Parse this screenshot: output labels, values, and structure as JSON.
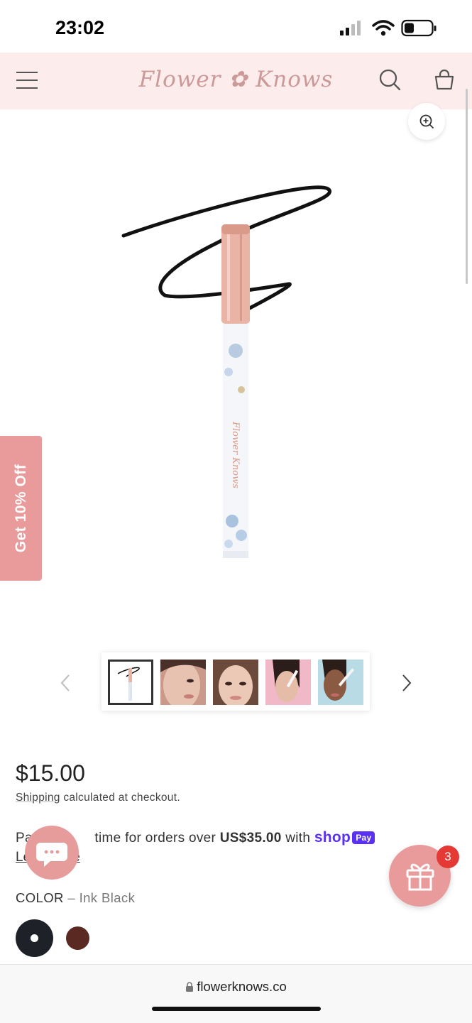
{
  "status_bar": {
    "time": "23:02"
  },
  "header": {
    "logo_text": "Flower ✿ Knows",
    "menu_icon": "hamburger-icon",
    "search_icon": "search-icon",
    "cart_icon": "bag-icon"
  },
  "promo": {
    "discount_tab": "Get 10% Off"
  },
  "gallery": {
    "thumbnails": [
      "eyeliner-product",
      "model-1",
      "model-2",
      "model-3",
      "model-4"
    ],
    "selected_index": 0
  },
  "product": {
    "price": "$15.00",
    "shipping_link": "Shipping",
    "shipping_rest": " calculated at checkout.",
    "pay_prefix": "Pa",
    "pay_middle": " time for orders over ",
    "pay_amount": "US$35.00",
    "pay_with": " with ",
    "shop_label": "shop",
    "pay_badge": "Pay",
    "learn_more_visible": "Le          re",
    "color_label": "COLOR",
    "color_sep": " – ",
    "color_value": "Ink Black",
    "swatches": [
      {
        "name": "Ink Black",
        "color": "#1f2128",
        "selected": true
      },
      {
        "name": "Brown",
        "color": "#5a2a22",
        "selected": false
      }
    ]
  },
  "floating": {
    "gift_badge_count": "3"
  },
  "browser": {
    "url": "flowerknows.co"
  },
  "colors": {
    "header_bg": "#fdecec",
    "accent_pink": "#e99a9a",
    "shop_purple": "#5a31f4"
  }
}
